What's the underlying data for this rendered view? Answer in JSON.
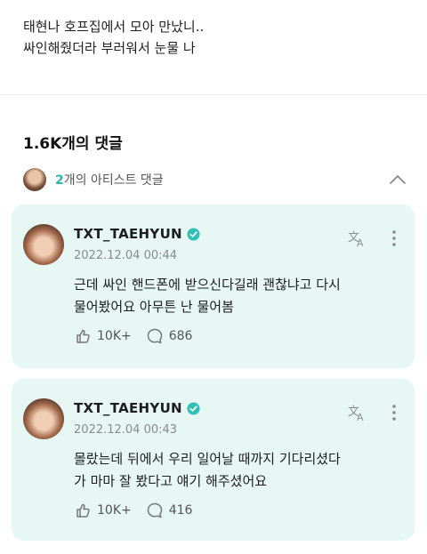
{
  "post": {
    "line1": "태현나 호프집에서 모아 만났니..",
    "line2": "싸인해줬더라 부러워서 눈물 나"
  },
  "comments_header": {
    "count_label": "1.6K개의 댓글"
  },
  "artist_comments": {
    "count": "2",
    "label_suffix": "개의 아티스트 댓글",
    "toggle_icon": "chevron-up-icon"
  },
  "comments": [
    {
      "author": "TXT_TAEHYUN",
      "date": "2022.12.04 00:44",
      "body_line1": "근데 싸인 핸드폰에 받으신다길래 괜찮냐고 다시",
      "body_line2": "물어봤어요 아무튼 난 물어봄",
      "likes": "10K+",
      "replies": "686"
    },
    {
      "author": "TXT_TAEHYUN",
      "date": "2022.12.04 00:43",
      "body_line1": "몰랐는데 뒤에서 우리 일어날 때까지 기다리셨다",
      "body_line2": "가 마마 잘 봤다고 얘기 해주셨어요",
      "likes": "10K+",
      "replies": "416"
    }
  ],
  "colors": {
    "accent": "#27b7ad",
    "card_bg": "#e6f7f4",
    "verified": "#2fc1b6"
  }
}
